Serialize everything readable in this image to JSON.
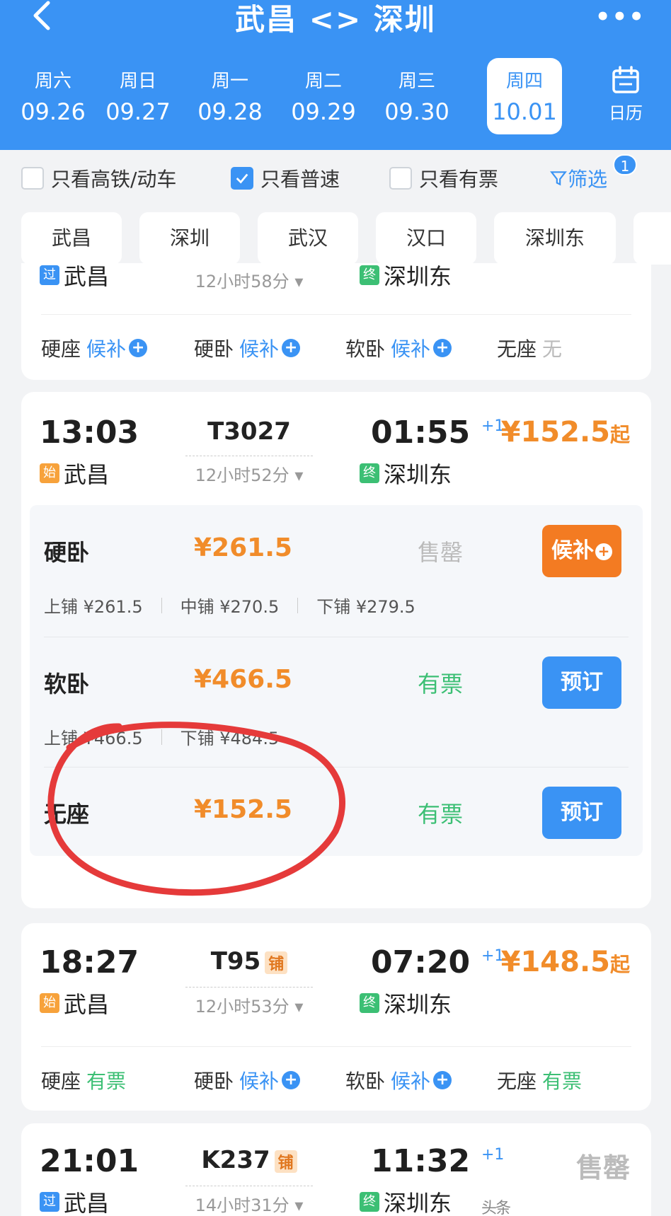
{
  "header": {
    "title": "武昌 <> 深圳",
    "dates": [
      {
        "weekday": "周六",
        "date": "09.26"
      },
      {
        "weekday": "周日",
        "date": "09.27"
      },
      {
        "weekday": "周一",
        "date": "09.28"
      },
      {
        "weekday": "周二",
        "date": "09.29"
      },
      {
        "weekday": "周三",
        "date": "09.30"
      },
      {
        "weekday": "周四",
        "date": "10.01"
      }
    ],
    "calendar_label": "日历"
  },
  "filters": {
    "high_speed": "只看高铁/动车",
    "normal": "只看普速",
    "has_ticket": "只看有票",
    "filter": "筛选",
    "filter_count": "1"
  },
  "stations": [
    "武昌",
    "深圳",
    "武汉",
    "汉口",
    "深圳东"
  ],
  "card0": {
    "from": "武昌",
    "duration": "12小时58分",
    "to": "深圳东",
    "seats": [
      {
        "name": "硬座",
        "status": "候补"
      },
      {
        "name": "硬卧",
        "status": "候补"
      },
      {
        "name": "软卧",
        "status": "候补"
      },
      {
        "name": "无座",
        "status": "无"
      }
    ]
  },
  "card1": {
    "depart": "13:03",
    "from_tag": "始",
    "from": "武昌",
    "train": "T3027",
    "duration": "12小时52分",
    "arrive": "01:55",
    "plus": "+1",
    "to_tag": "终",
    "to": "深圳东",
    "price": "¥152.5",
    "price_suffix": "起",
    "rows": [
      {
        "name": "硬卧",
        "price": "¥261.5",
        "status": "售罄",
        "button": "候补",
        "berths": [
          "上铺 ¥261.5",
          "中铺 ¥270.5",
          "下铺 ¥279.5"
        ]
      },
      {
        "name": "软卧",
        "price": "¥466.5",
        "status": "有票",
        "button": "预订",
        "berths": [
          "上铺 ¥466.5",
          "下铺 ¥484.5"
        ]
      },
      {
        "name": "无座",
        "price": "¥152.5",
        "status": "有票",
        "button": "预订"
      }
    ]
  },
  "card2": {
    "depart": "18:27",
    "from_tag": "始",
    "from": "武昌",
    "train": "T95",
    "pu": "铺",
    "duration": "12小时53分",
    "arrive": "07:20",
    "plus": "+1",
    "to_tag": "终",
    "to": "深圳东",
    "price": "¥148.5",
    "price_suffix": "起",
    "seats": [
      {
        "name": "硬座",
        "status": "有票"
      },
      {
        "name": "硬卧",
        "status": "候补"
      },
      {
        "name": "软卧",
        "status": "候补"
      },
      {
        "name": "无座",
        "status": "有票"
      }
    ]
  },
  "card3": {
    "depart": "21:01",
    "from_tag": "过",
    "from": "武昌",
    "train": "K237",
    "pu": "铺",
    "duration": "14小时31分",
    "arrive": "11:32",
    "plus": "+1",
    "to_tag": "终",
    "to": "深圳东",
    "status": "售罄"
  },
  "tags": {
    "pass": "过",
    "end": "终"
  },
  "colors": {
    "primary": "#3a93f4",
    "orange": "#f18c2a",
    "green": "#3cbf74",
    "annotation": "#e53a3a"
  },
  "watermark": "头条"
}
